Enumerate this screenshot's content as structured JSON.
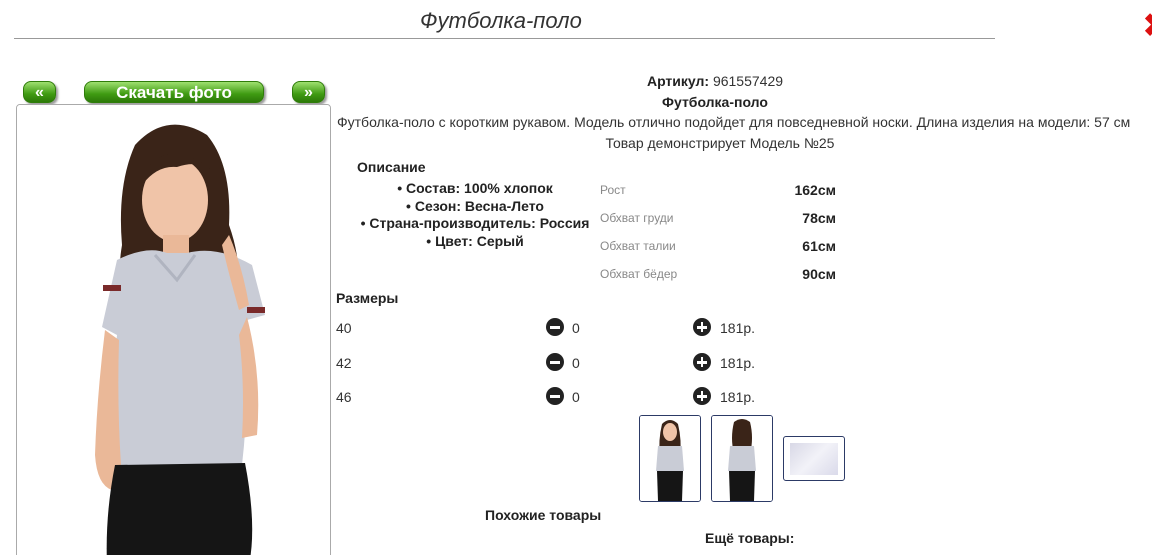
{
  "page": {
    "title": "Футболка-поло",
    "close_icon": "close-x-icon"
  },
  "gallery": {
    "prev_label": "«",
    "download_label": "Скачать фото",
    "next_label": "»"
  },
  "product": {
    "article_label": "Артикул:",
    "article_value": "961557429",
    "name": "Футболка-поло",
    "description": "Футболка-поло с коротким рукавом. Модель отлично подойдет для повседневной носки. Длина изделия на модели: 57 см",
    "model_note": "Товар демонстрирует Модель №25"
  },
  "specs": {
    "title": "Описание",
    "items": [
      "Состав: 100% хлопок",
      "Сезон: Весна-Лето",
      "Страна-производитель: Россия",
      "Цвет: Серый"
    ]
  },
  "measurements": [
    {
      "label": "Рост",
      "value": "162см"
    },
    {
      "label": "Обхват груди",
      "value": "78см"
    },
    {
      "label": "Обхват талии",
      "value": "61см"
    },
    {
      "label": "Обхват бёдер",
      "value": "90см"
    }
  ],
  "sizes": {
    "title": "Размеры",
    "rows": [
      {
        "size": "40",
        "qty": "0",
        "price": "181р."
      },
      {
        "size": "42",
        "qty": "0",
        "price": "181р."
      },
      {
        "size": "46",
        "qty": "0",
        "price": "181р."
      }
    ]
  },
  "footer": {
    "similar_label": "Похожие товары",
    "more_label": "Ещё товары:"
  },
  "colors": {
    "button_green": "#3f9b12",
    "close_red": "#dd1111",
    "link_green": "#1a8a1a"
  }
}
